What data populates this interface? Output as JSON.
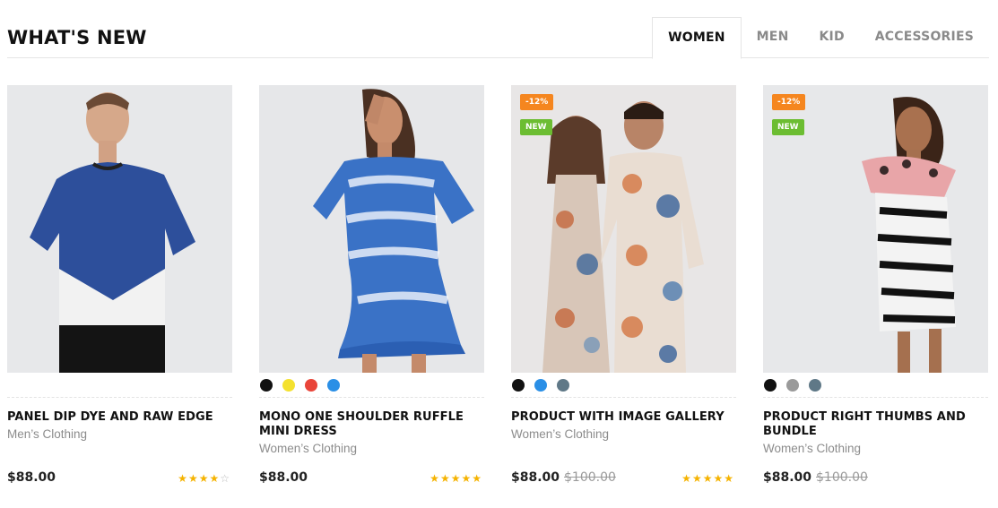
{
  "section_title": "WHAT'S NEW",
  "tabs": [
    {
      "label": "WOMEN",
      "active": true
    },
    {
      "label": "MEN",
      "active": false
    },
    {
      "label": "KID",
      "active": false
    },
    {
      "label": "ACCESSORIES",
      "active": false
    }
  ],
  "products": [
    {
      "name": "PANEL DIP DYE AND RAW EDGE",
      "category": "Men’s Clothing",
      "price": "$88.00",
      "old_price": "",
      "rating": 4,
      "badges": [],
      "swatches": []
    },
    {
      "name": "MONO ONE SHOULDER RUFFLE MINI DRESS",
      "category": "Women’s Clothing",
      "price": "$88.00",
      "old_price": "",
      "rating": 5,
      "badges": [],
      "swatches": [
        "#111111",
        "#f4e12f",
        "#e9453a",
        "#2a8fe6"
      ]
    },
    {
      "name": "PRODUCT WITH IMAGE GALLERY",
      "category": "Women’s Clothing",
      "price": "$88.00",
      "old_price": "$100.00",
      "rating": 5,
      "badges": [
        "-12%",
        "NEW"
      ],
      "swatches": [
        "#111111",
        "#2a8fe6",
        "#5f7887"
      ]
    },
    {
      "name": "PRODUCT RIGHT THUMBS AND BUNDLE",
      "category": "Women’s Clothing",
      "price": "$88.00",
      "old_price": "$100.00",
      "rating": 0,
      "badges": [
        "-12%",
        "NEW"
      ],
      "swatches": [
        "#111111",
        "#9a9a9a",
        "#5f7887"
      ]
    }
  ],
  "colors": {
    "sale_badge": "#f5861f",
    "new_badge": "#6cbd32",
    "star": "#f5b301"
  }
}
